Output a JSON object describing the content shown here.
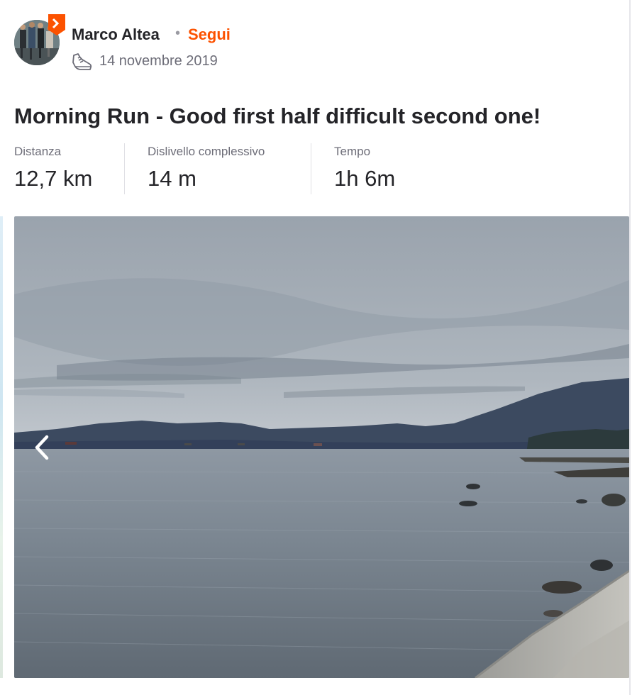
{
  "athlete": {
    "name": "Marco Altea",
    "separator": "•",
    "follow_label": "Segui"
  },
  "activity": {
    "date": "14 novembre 2019",
    "sport_icon": "running-shoe-icon",
    "title": "Morning Run - Good first half difficult second one!"
  },
  "stats": [
    {
      "label": "Distanza",
      "value": "12,7 km"
    },
    {
      "label": "Dislivello complessivo",
      "value": "14 m"
    },
    {
      "label": "Tempo",
      "value": "1h 6m"
    }
  ],
  "photo": {
    "nav_icon": "chevron-left-icon"
  },
  "colors": {
    "accent": "#fc5200",
    "text": "#242428",
    "muted": "#6d6d78"
  }
}
